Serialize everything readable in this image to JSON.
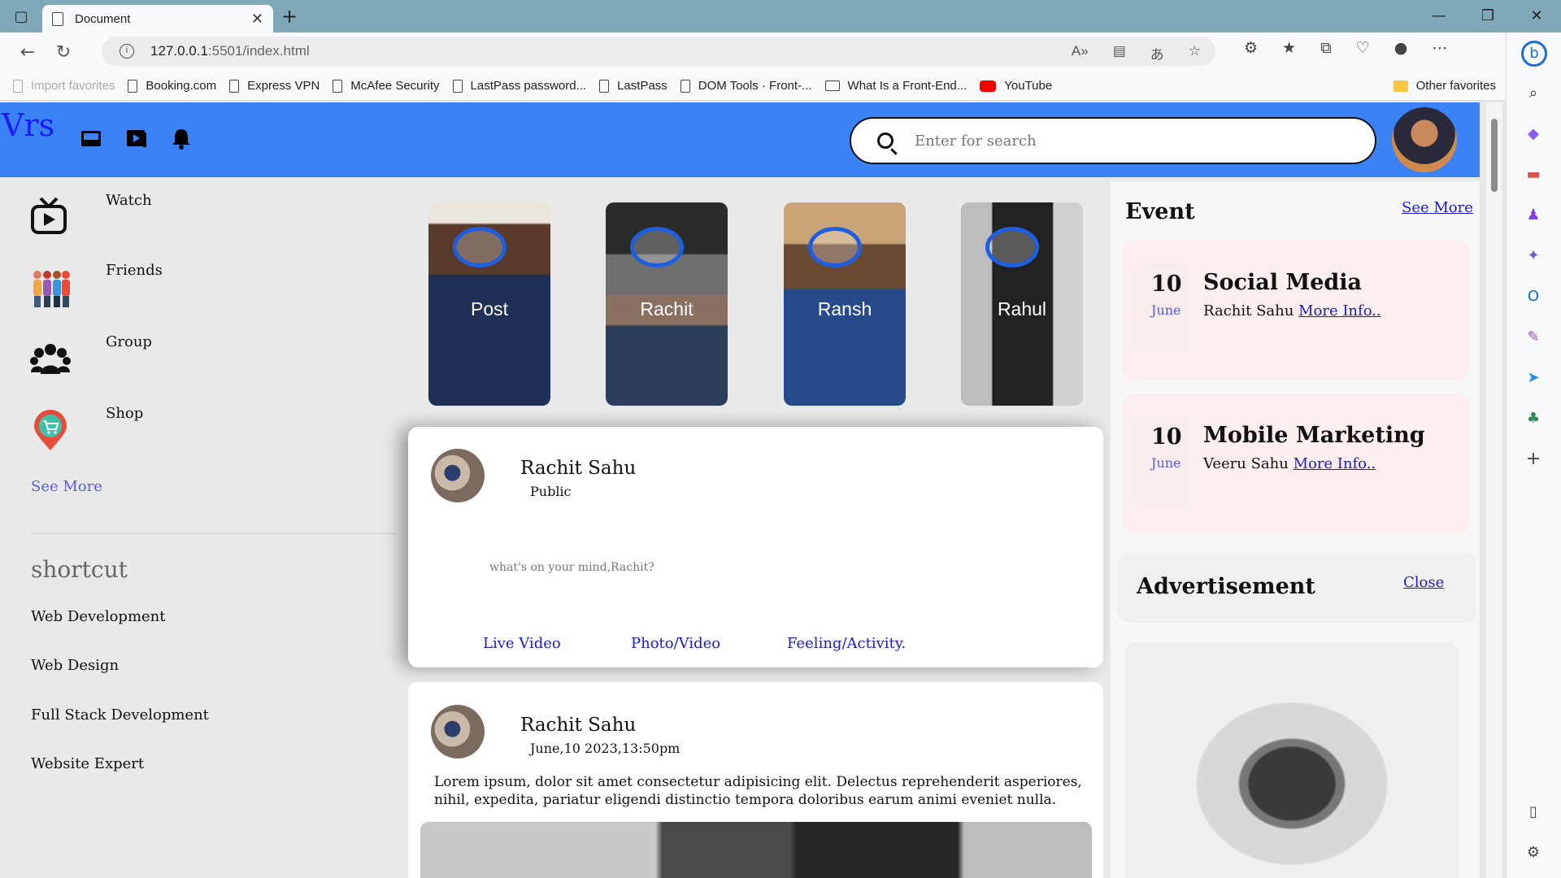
{
  "browser": {
    "tab_title": "Document",
    "url_host": "127.0.0.1",
    "url_path": ":5501/index.html",
    "favorites": [
      "Import favorites",
      "Booking.com",
      "Express VPN",
      "McAfee Security",
      "LastPass password...",
      "LastPass",
      "DOM Tools · Front-...",
      "What Is a Front-End...",
      "YouTube"
    ],
    "other_favorites": "Other favorites"
  },
  "header": {
    "logo": "Vrs",
    "search_placeholder": "Enter for search"
  },
  "sidebar": {
    "items": [
      {
        "label": "Watch",
        "icon": "tv-icon"
      },
      {
        "label": "Friends",
        "icon": "friends-icon"
      },
      {
        "label": "Group",
        "icon": "group-icon"
      },
      {
        "label": "Shop",
        "icon": "shop-icon"
      }
    ],
    "see_more": "See More",
    "shortcut_title": "shortcut",
    "shortcuts": [
      "Web Development",
      "Web Design",
      "Full Stack Development",
      "Website Expert"
    ]
  },
  "stories": [
    "Post",
    "Rachit",
    "Ransh",
    "Rahul"
  ],
  "composer": {
    "name": "Rachit Sahu",
    "visibility": "Public",
    "prompt": "what's on your mind,Rachit?",
    "actions": [
      "Live Video",
      "Photo/Video",
      "Feeling/Activity."
    ]
  },
  "post": {
    "name": "Rachit Sahu",
    "date": "June,10 2023,13:50pm",
    "text": "Lorem ipsum, dolor sit amet consectetur adipisicing elit. Delectus reprehenderit asperiores, nihil, expedita, pariatur eligendi distinctio tempora doloribus earum animi eveniet nulla."
  },
  "events": {
    "title": "Event",
    "see_more": "See More",
    "items": [
      {
        "day": "10",
        "month": "June",
        "title": "Social Media",
        "host": "Rachit Sahu",
        "link": "More Info.."
      },
      {
        "day": "10",
        "month": "June",
        "title": "Mobile Marketing",
        "host": "Veeru Sahu",
        "link": "More Info.."
      }
    ]
  },
  "advertisement": {
    "title": "Advertisement",
    "close": "Close"
  }
}
